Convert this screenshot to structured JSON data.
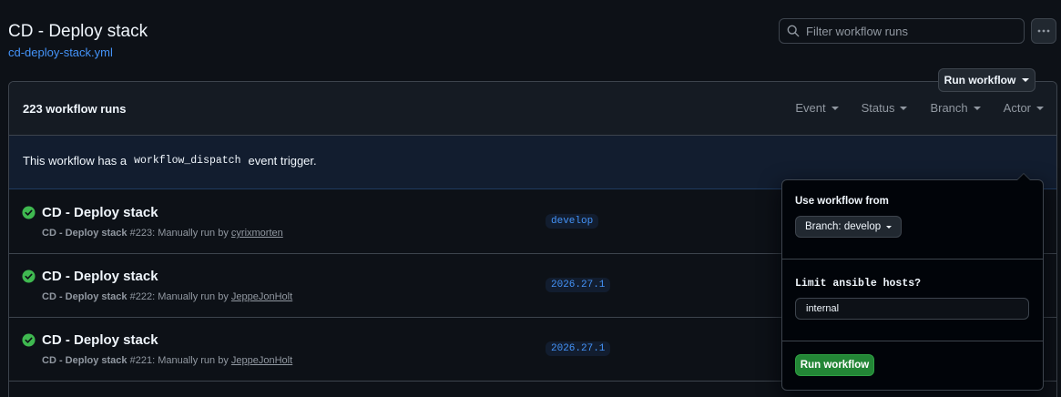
{
  "header": {
    "title": "CD - Deploy stack",
    "file_link": "cd-deploy-stack.yml",
    "search_placeholder": "Filter workflow runs"
  },
  "runs_header": {
    "count_label": "223 workflow runs",
    "filters": [
      "Event",
      "Status",
      "Branch",
      "Actor"
    ]
  },
  "dispatch_banner": {
    "text_before": "This workflow has a",
    "code": "workflow_dispatch",
    "text_after": "event trigger.",
    "button_label": "Run workflow"
  },
  "runs": [
    {
      "title": "CD - Deploy stack",
      "workflow": "CD - Deploy stack",
      "run_number": "#223",
      "trigger_text": ": Manually run by",
      "actor": "cyrixmorten",
      "branch": "develop",
      "status": "success"
    },
    {
      "title": "CD - Deploy stack",
      "workflow": "CD - Deploy stack",
      "run_number": "#222",
      "trigger_text": ": Manually run by",
      "actor": "JeppeJonHolt",
      "branch": "2026.27.1",
      "status": "success"
    },
    {
      "title": "CD - Deploy stack",
      "workflow": "CD - Deploy stack",
      "run_number": "#221",
      "trigger_text": ": Manually run by",
      "actor": "JeppeJonHolt",
      "branch": "2026.27.1",
      "status": "success"
    }
  ],
  "dropdown": {
    "use_from_label": "Use workflow from",
    "branch_select": "Branch: develop",
    "limit_label": "Limit ansible hosts?",
    "limit_value": "internal",
    "submit_label": "Run workflow"
  },
  "colors": {
    "background": "#0d1117",
    "link": "#4493f8",
    "success": "#3fb950",
    "primary_button": "#238636"
  },
  "icons": [
    "search-icon",
    "kebab-horizontal-icon",
    "check-circle-icon"
  ]
}
